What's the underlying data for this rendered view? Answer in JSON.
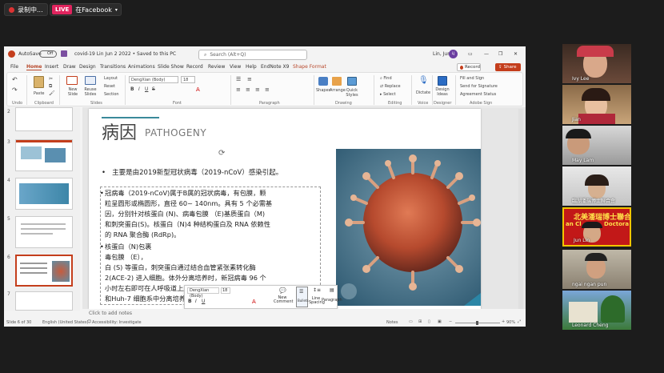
{
  "top": {
    "record_label": "录制中...",
    "live_tag": "LIVE",
    "live_label": "在Facebook"
  },
  "ppt": {
    "autosave": "AutoSave",
    "autosave_state": "Off",
    "doc_title": "covid-19 Lin Jun 2 2022 • Saved to this PC",
    "search_placeholder": "Search (Alt+Q)",
    "user": "Lin, Jun",
    "user_initials": "LJ",
    "menu": [
      "File",
      "Home",
      "Insert",
      "Draw",
      "Design",
      "Transitions",
      "Animations",
      "Slide Show",
      "Record",
      "Review",
      "View",
      "Help",
      "EndNote X9",
      "Shape Format"
    ],
    "record_btn": "Record",
    "share_btn": "Share",
    "ribbon": {
      "paste": "Paste",
      "new_slide": "New Slide",
      "reuse_slides": "Reuse Slides",
      "layout": "Layout",
      "reset": "Reset",
      "section": "Section",
      "font_name": "DengXian (Body)",
      "font_size": "18",
      "shapes": "Shapes",
      "arrange": "Arrange",
      "quick_styles": "Quick Styles",
      "find": "Find",
      "replace": "Replace",
      "select": "Select",
      "dictate": "Dictate",
      "design_ideas": "Design Ideas",
      "fill_sign": "Fill and Sign",
      "send_sig": "Send for Signature",
      "agreement": "Agreement Status",
      "groups": [
        "Undo",
        "Clipboard",
        "Slides",
        "Font",
        "Paragraph",
        "Drawing",
        "Editing",
        "Voice",
        "Designer",
        "Adobe Sign"
      ]
    },
    "thumbs": [
      "2",
      "3",
      "4",
      "5",
      "6",
      "7"
    ],
    "slide": {
      "title_cn": "病因",
      "title_en": "PATHOGENY",
      "bullet1": "主要是由2019新型冠状病毒（2019-nCoV）感染引起。",
      "lines": [
        "冠病毒（2019-nCoV)属于B属的冠状病毒，有包膜，颗",
        "粒呈圆形或椭圆形，直径 60~ 140nm。具有 5 个必需基",
        "因，分别针对核蛋白 (N)、病毒包膜 （E)基质蛋白（M)",
        "和刺突蛋白(S)。核蛋白（N)4 种结构蛋白及 RNA 依赖性",
        "的 RNA 聚合酶 (RdRp)。",
        "核蛋白（N)包裹",
        "毒包膜    （E），",
        "白 (S) 等蛋白，刺突蛋白通过结合血管紧张素转化酶",
        "2(ACE-2) 进入细胞。体外分离培养时，新冠病毒 96 个",
        "小时左右即可在人呼吸道上皮细胞内发现，而在 VeroE6",
        "和Huh-7 细胞系中分离培养约需 4~6 天。"
      ]
    },
    "minitool": {
      "font": "DengXian (Body)",
      "size": "18",
      "new_comment": "New Comment",
      "bullets": "Bullets",
      "line_spacing": "Line Spacing",
      "paragraph": "Paragraph"
    },
    "notes_hint": "Click to add notes",
    "status": {
      "slide_info": "Slide 6 of 30",
      "language": "English (United States)",
      "accessibility": "Accessibility: Investigate",
      "notes": "Notes",
      "zoom": "90%"
    }
  },
  "participants": [
    {
      "name": "Ivy Lee"
    },
    {
      "name": "Jian"
    },
    {
      "name": "May Lam"
    },
    {
      "name": "臨湖潘瑞博士聯合會"
    },
    {
      "name": "Jun Lin",
      "banner": "北美潘瑞博士聯合會",
      "banner2": "an Cl",
      "banner3": "Doctora"
    },
    {
      "name": "ngai ngan pun"
    },
    {
      "name": "Leonard Cheng"
    }
  ]
}
